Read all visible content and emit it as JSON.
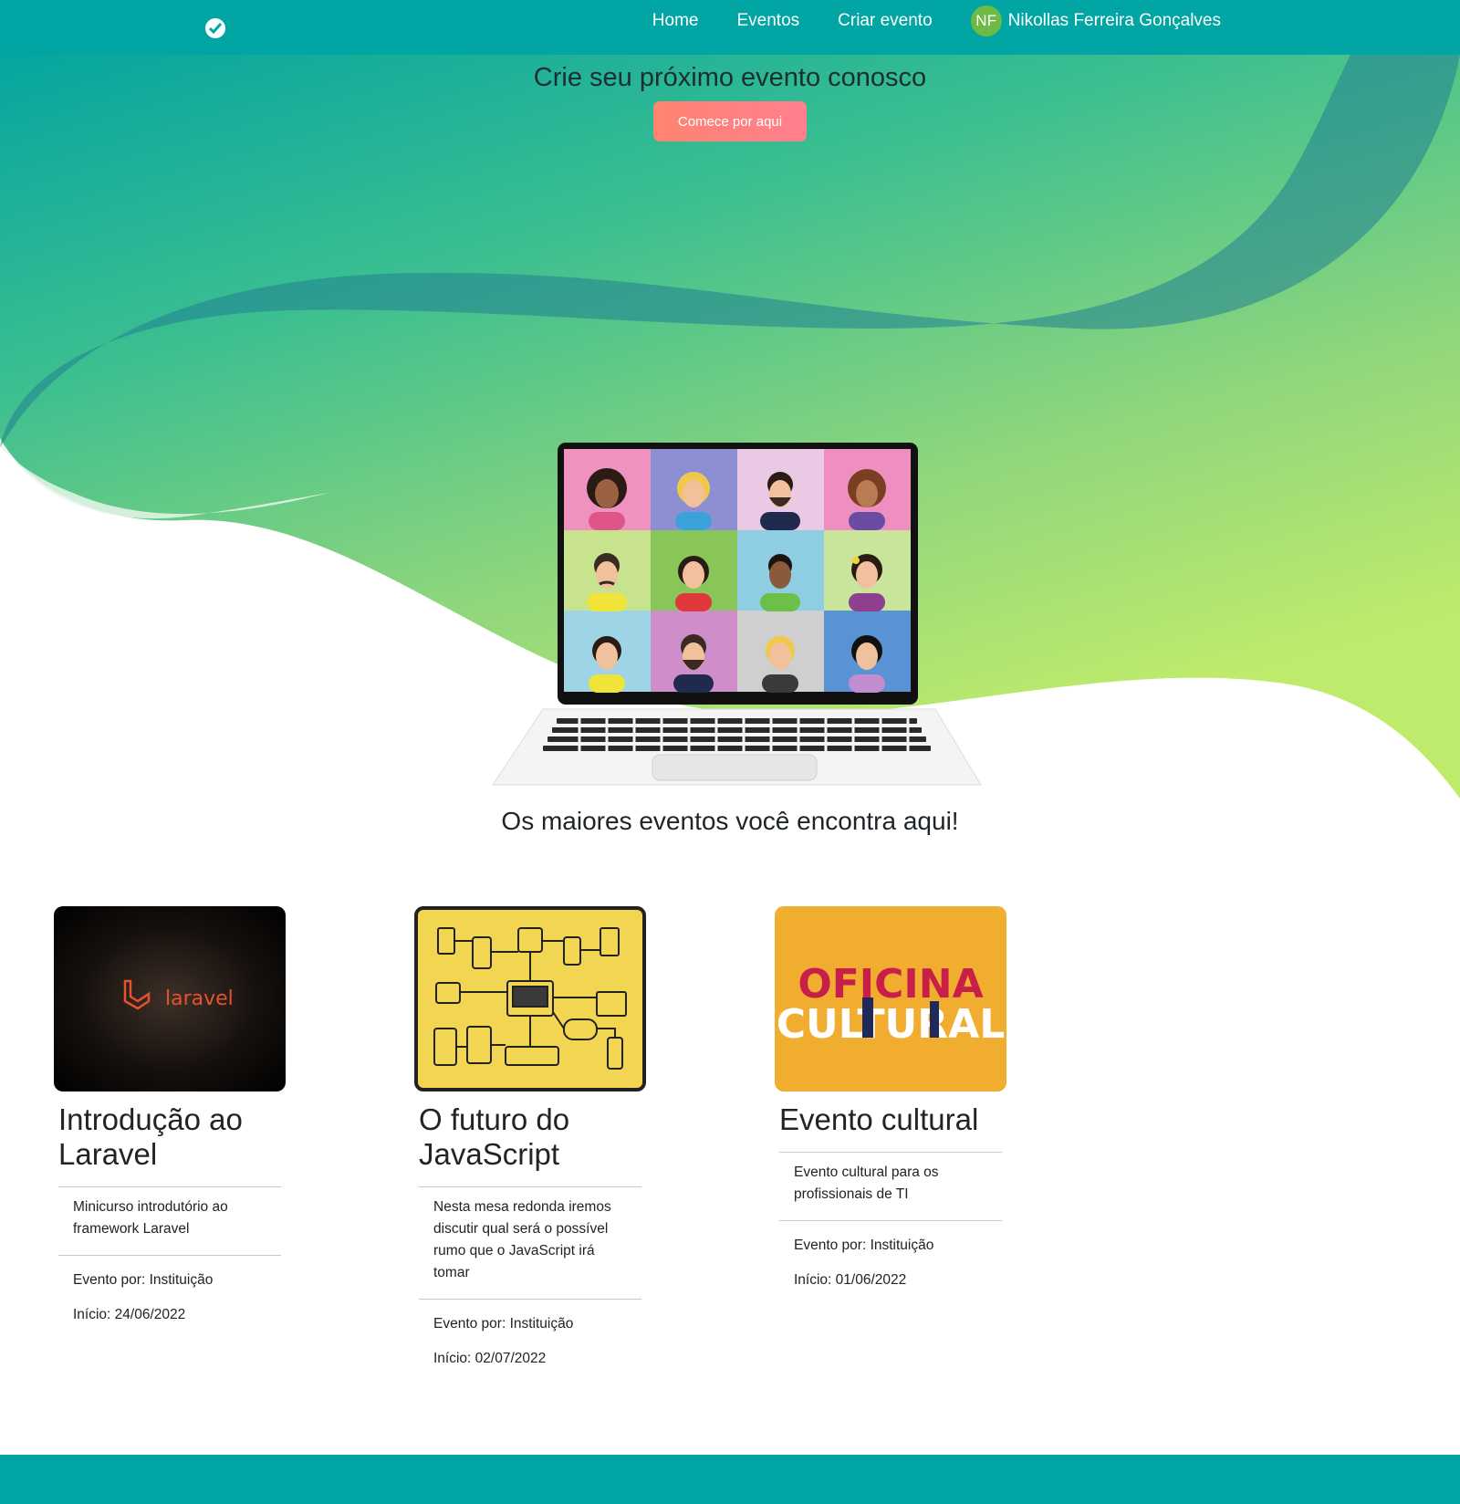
{
  "colors": {
    "navbar": "#01a5a3",
    "cta": "#ff8176",
    "avatar": "#6dbb45",
    "footer": "#01a5a3"
  },
  "navbar": {
    "brand_icon": "check-circle-icon",
    "links": [
      "Home",
      "Eventos",
      "Criar evento"
    ],
    "user": {
      "initials": "NF",
      "name": "Nikollas Ferreira Gonçalves"
    }
  },
  "hero": {
    "title": "Crie seu próximo evento conosco",
    "cta_label": "Comece por aqui",
    "illustration": "laptop-video-call-icon"
  },
  "events_section": {
    "title": "Os maiores eventos você encontra aqui!",
    "cards": [
      {
        "image": "laravel-logo-image",
        "image_text": "laravel",
        "title": "Introdução ao Laravel",
        "description": "Minicurso introdutório ao framework Laravel",
        "organizer": "Evento por: Instituição",
        "start": "Início: 24/06/2022"
      },
      {
        "image": "devices-circuit-image",
        "title": "O futuro do JavaScript",
        "description": "Nesta mesa redonda iremos discutir qual será o possível rumo que o JavaScript irá tomar",
        "organizer": "Evento por: Instituição",
        "start": "Início: 02/07/2022"
      },
      {
        "image": "oficina-cultural-image",
        "image_text": [
          "OFICINA",
          "CULTURAL"
        ],
        "title": "Evento cultural",
        "description": "Evento cultural para os profissionais de TI",
        "organizer": "Evento por: Instituição",
        "start": "Início: 01/06/2022"
      }
    ]
  }
}
